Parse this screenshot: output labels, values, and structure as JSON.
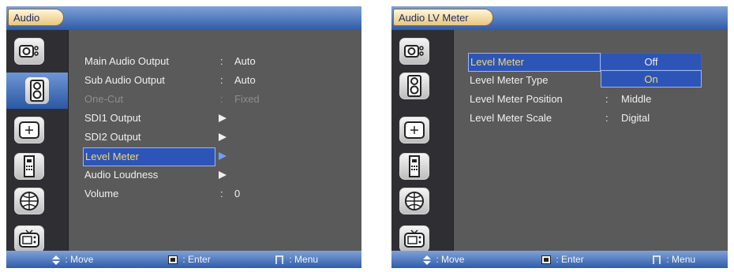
{
  "left_panel": {
    "title": "Audio",
    "menu": [
      {
        "label": "Main Audio Output",
        "colon": ":",
        "value": "Auto",
        "state": "normal"
      },
      {
        "label": "Sub Audio Output",
        "colon": ":",
        "value": "Auto",
        "state": "normal"
      },
      {
        "label": "One-Cut",
        "colon": ":",
        "value": "Fixed",
        "state": "disabled"
      },
      {
        "label": "SDI1 Output",
        "colon": "",
        "value": "",
        "state": "submenu"
      },
      {
        "label": "SDI2 Output",
        "colon": "",
        "value": "",
        "state": "submenu"
      },
      {
        "label": "Level Meter",
        "colon": "",
        "value": "",
        "state": "selected"
      },
      {
        "label": "Audio Loudness",
        "colon": "",
        "value": "",
        "state": "submenu"
      },
      {
        "label": "Volume",
        "colon": ":",
        "value": "0",
        "state": "normal"
      }
    ],
    "footer": {
      "move": "Move",
      "enter": "Enter",
      "menu": "Menu",
      "enter_prefix": ":",
      "menu_prefix": ":",
      "move_prefix": ":"
    }
  },
  "right_panel": {
    "title": "Audio LV Meter",
    "menu": [
      {
        "label": "Level Meter",
        "colon": "",
        "value": "",
        "state": "selected"
      },
      {
        "label": "Level Meter Type",
        "colon": ":",
        "value": "",
        "state": "normal"
      },
      {
        "label": "Level Meter Position",
        "colon": ":",
        "value": "Middle",
        "state": "normal"
      },
      {
        "label": "Level Meter Scale",
        "colon": ":",
        "value": "Digital",
        "state": "normal"
      }
    ],
    "popup": [
      "Off",
      "On"
    ],
    "popup_selected": "On",
    "footer": {
      "move": "Move",
      "enter": "Enter",
      "menu": "Menu",
      "enter_prefix": ":",
      "menu_prefix": ":",
      "move_prefix": ":"
    }
  },
  "sidebar_icons": [
    "camera-settings-icon",
    "speaker-icon",
    "crosshair-icon",
    "remote-icon",
    "network-globe-icon",
    "tv-icon"
  ],
  "colors": {
    "accent_blue": "#2d55b8",
    "highlight_text": "#f4d86a",
    "panel_bg": "#5a5a5a",
    "sidebar_bg": "#2f2f33"
  }
}
